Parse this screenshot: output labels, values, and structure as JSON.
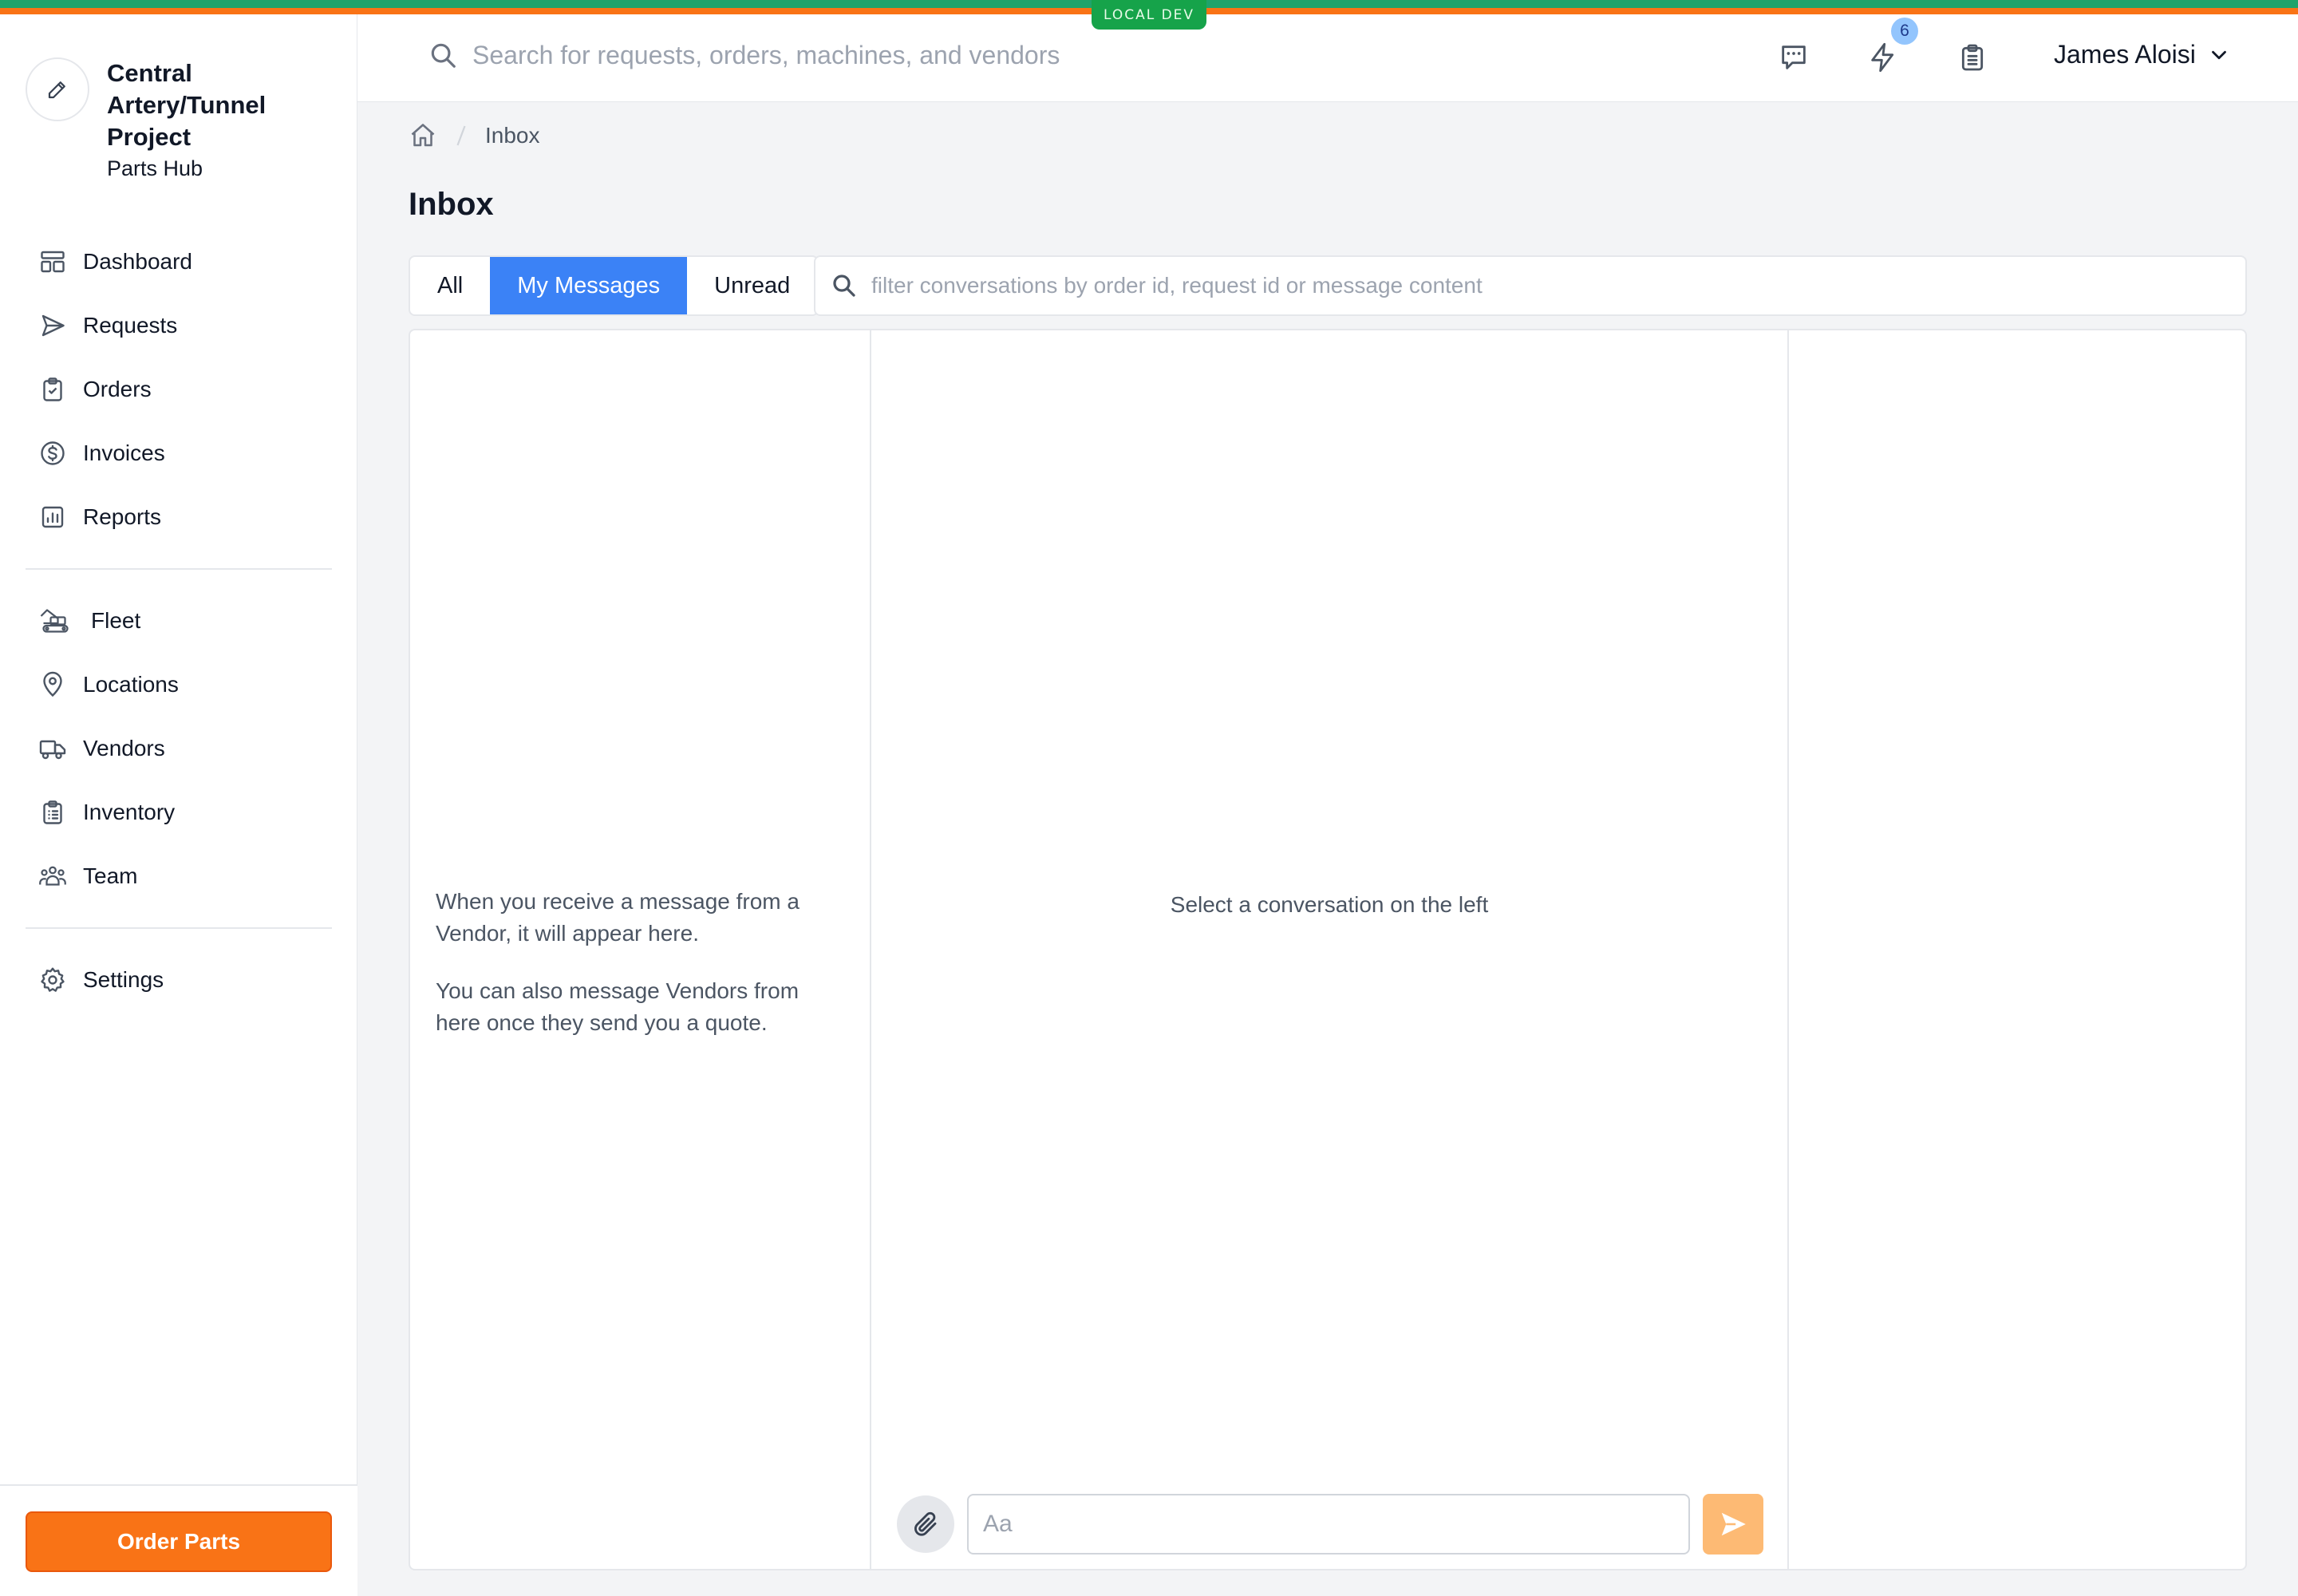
{
  "env": {
    "label": "LOCAL DEV"
  },
  "brand": {
    "title_line1": "Central",
    "title_line2": "Artery/Tunnel",
    "title_line3": "Project",
    "subtitle": "Parts Hub"
  },
  "sidebar": {
    "primary": [
      {
        "label": "Dashboard",
        "icon": "dashboard-icon"
      },
      {
        "label": "Requests",
        "icon": "send-icon"
      },
      {
        "label": "Orders",
        "icon": "clipboard-check-icon"
      },
      {
        "label": "Invoices",
        "icon": "dollar-circle-icon"
      },
      {
        "label": "Reports",
        "icon": "chart-icon"
      }
    ],
    "secondary": [
      {
        "label": "Fleet",
        "icon": "excavator-icon"
      },
      {
        "label": "Locations",
        "icon": "location-pin-icon"
      },
      {
        "label": "Vendors",
        "icon": "truck-icon"
      },
      {
        "label": "Inventory",
        "icon": "clipboard-list-icon"
      },
      {
        "label": "Team",
        "icon": "team-icon"
      }
    ],
    "tertiary": [
      {
        "label": "Settings",
        "icon": "gear-icon"
      }
    ],
    "order_button": "Order Parts"
  },
  "header": {
    "search_placeholder": "Search for requests, orders, machines, and vendors",
    "notification_count": "6",
    "user_name": "James Aloisi"
  },
  "breadcrumb": {
    "current": "Inbox"
  },
  "page": {
    "title": "Inbox"
  },
  "tabs": [
    {
      "label": "All",
      "active": false
    },
    {
      "label": "My Messages",
      "active": true
    },
    {
      "label": "Unread",
      "active": false
    }
  ],
  "filter": {
    "placeholder": "filter conversations by order id, request id or message content"
  },
  "conversations": {
    "empty_line1": "When you receive a message from a Vendor, it will appear here.",
    "empty_line2": "You can also message Vendors from here once they send you a quote."
  },
  "thread": {
    "hint": "Select a conversation on the left",
    "composer_placeholder": "Aa"
  },
  "colors": {
    "accent": "#3b82f6",
    "primary_action": "#f97316",
    "send_disabled": "#fdba74",
    "env_badge": "#16a34a"
  }
}
